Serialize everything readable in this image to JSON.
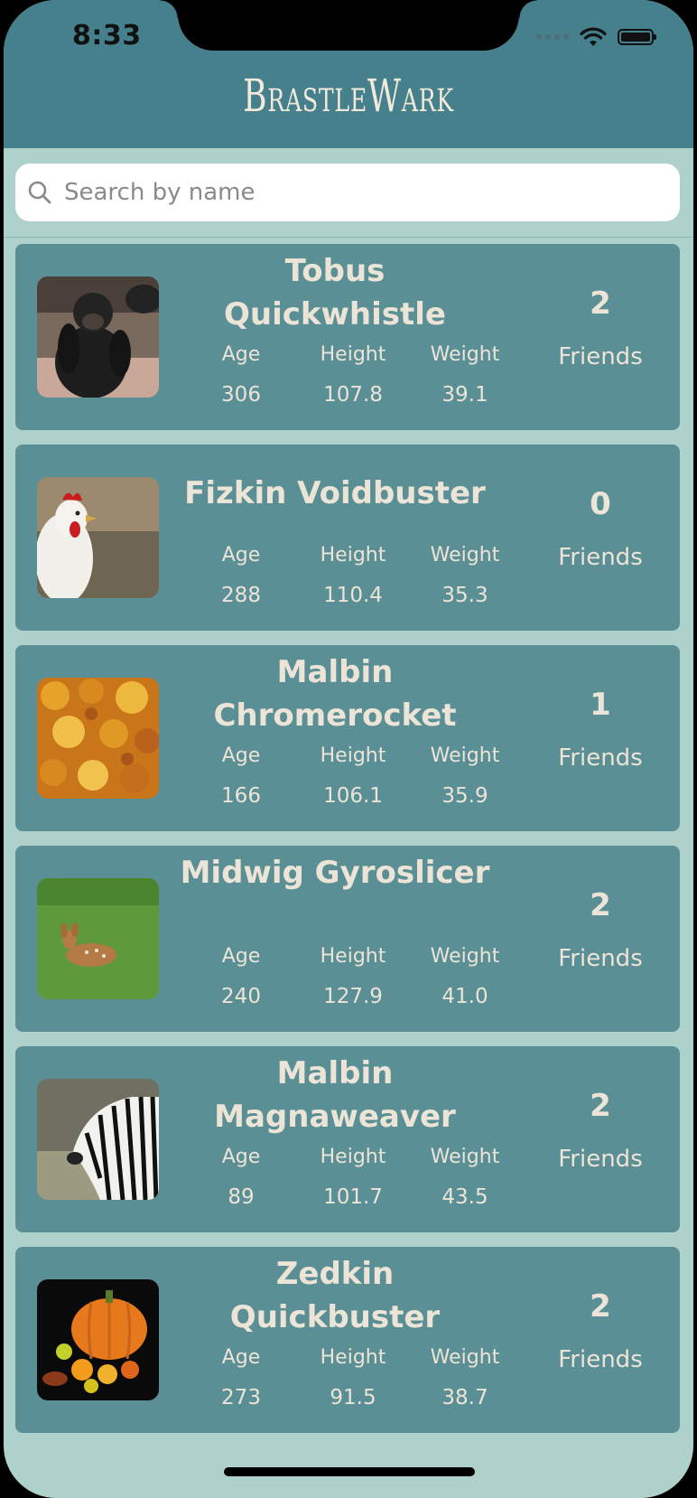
{
  "status_bar": {
    "time": "8:33"
  },
  "header": {
    "title": "BrastleWark"
  },
  "search": {
    "placeholder": "Search by name",
    "value": ""
  },
  "colors": {
    "header_bg": "#45808c",
    "page_bg": "#aed1cb",
    "card_bg": "#5b8f96",
    "text": "#ece4d6"
  },
  "labels": {
    "age": "Age",
    "height": "Height",
    "weight": "Weight",
    "friends": "Friends"
  },
  "gnomes": [
    {
      "name": "Tobus Quickwhistle",
      "age": "306",
      "height": "107.8",
      "weight": "39.1",
      "friends": "2",
      "thumbnail": "chimpanzee"
    },
    {
      "name": "Fizkin Voidbuster",
      "age": "288",
      "height": "110.4",
      "weight": "35.3",
      "friends": "0",
      "thumbnail": "rooster"
    },
    {
      "name": "Malbin Chromerocket",
      "age": "166",
      "height": "106.1",
      "weight": "35.9",
      "friends": "1",
      "thumbnail": "autumn-leaves"
    },
    {
      "name": "Midwig Gyroslicer",
      "age": "240",
      "height": "127.9",
      "weight": "41.0",
      "friends": "2",
      "thumbnail": "fawn"
    },
    {
      "name": "Malbin Magnaweaver",
      "age": "89",
      "height": "101.7",
      "weight": "43.5",
      "friends": "2",
      "thumbnail": "zebra"
    },
    {
      "name": "Zedkin Quickbuster",
      "age": "273",
      "height": "91.5",
      "weight": "38.7",
      "friends": "2",
      "thumbnail": "pumpkin"
    }
  ]
}
